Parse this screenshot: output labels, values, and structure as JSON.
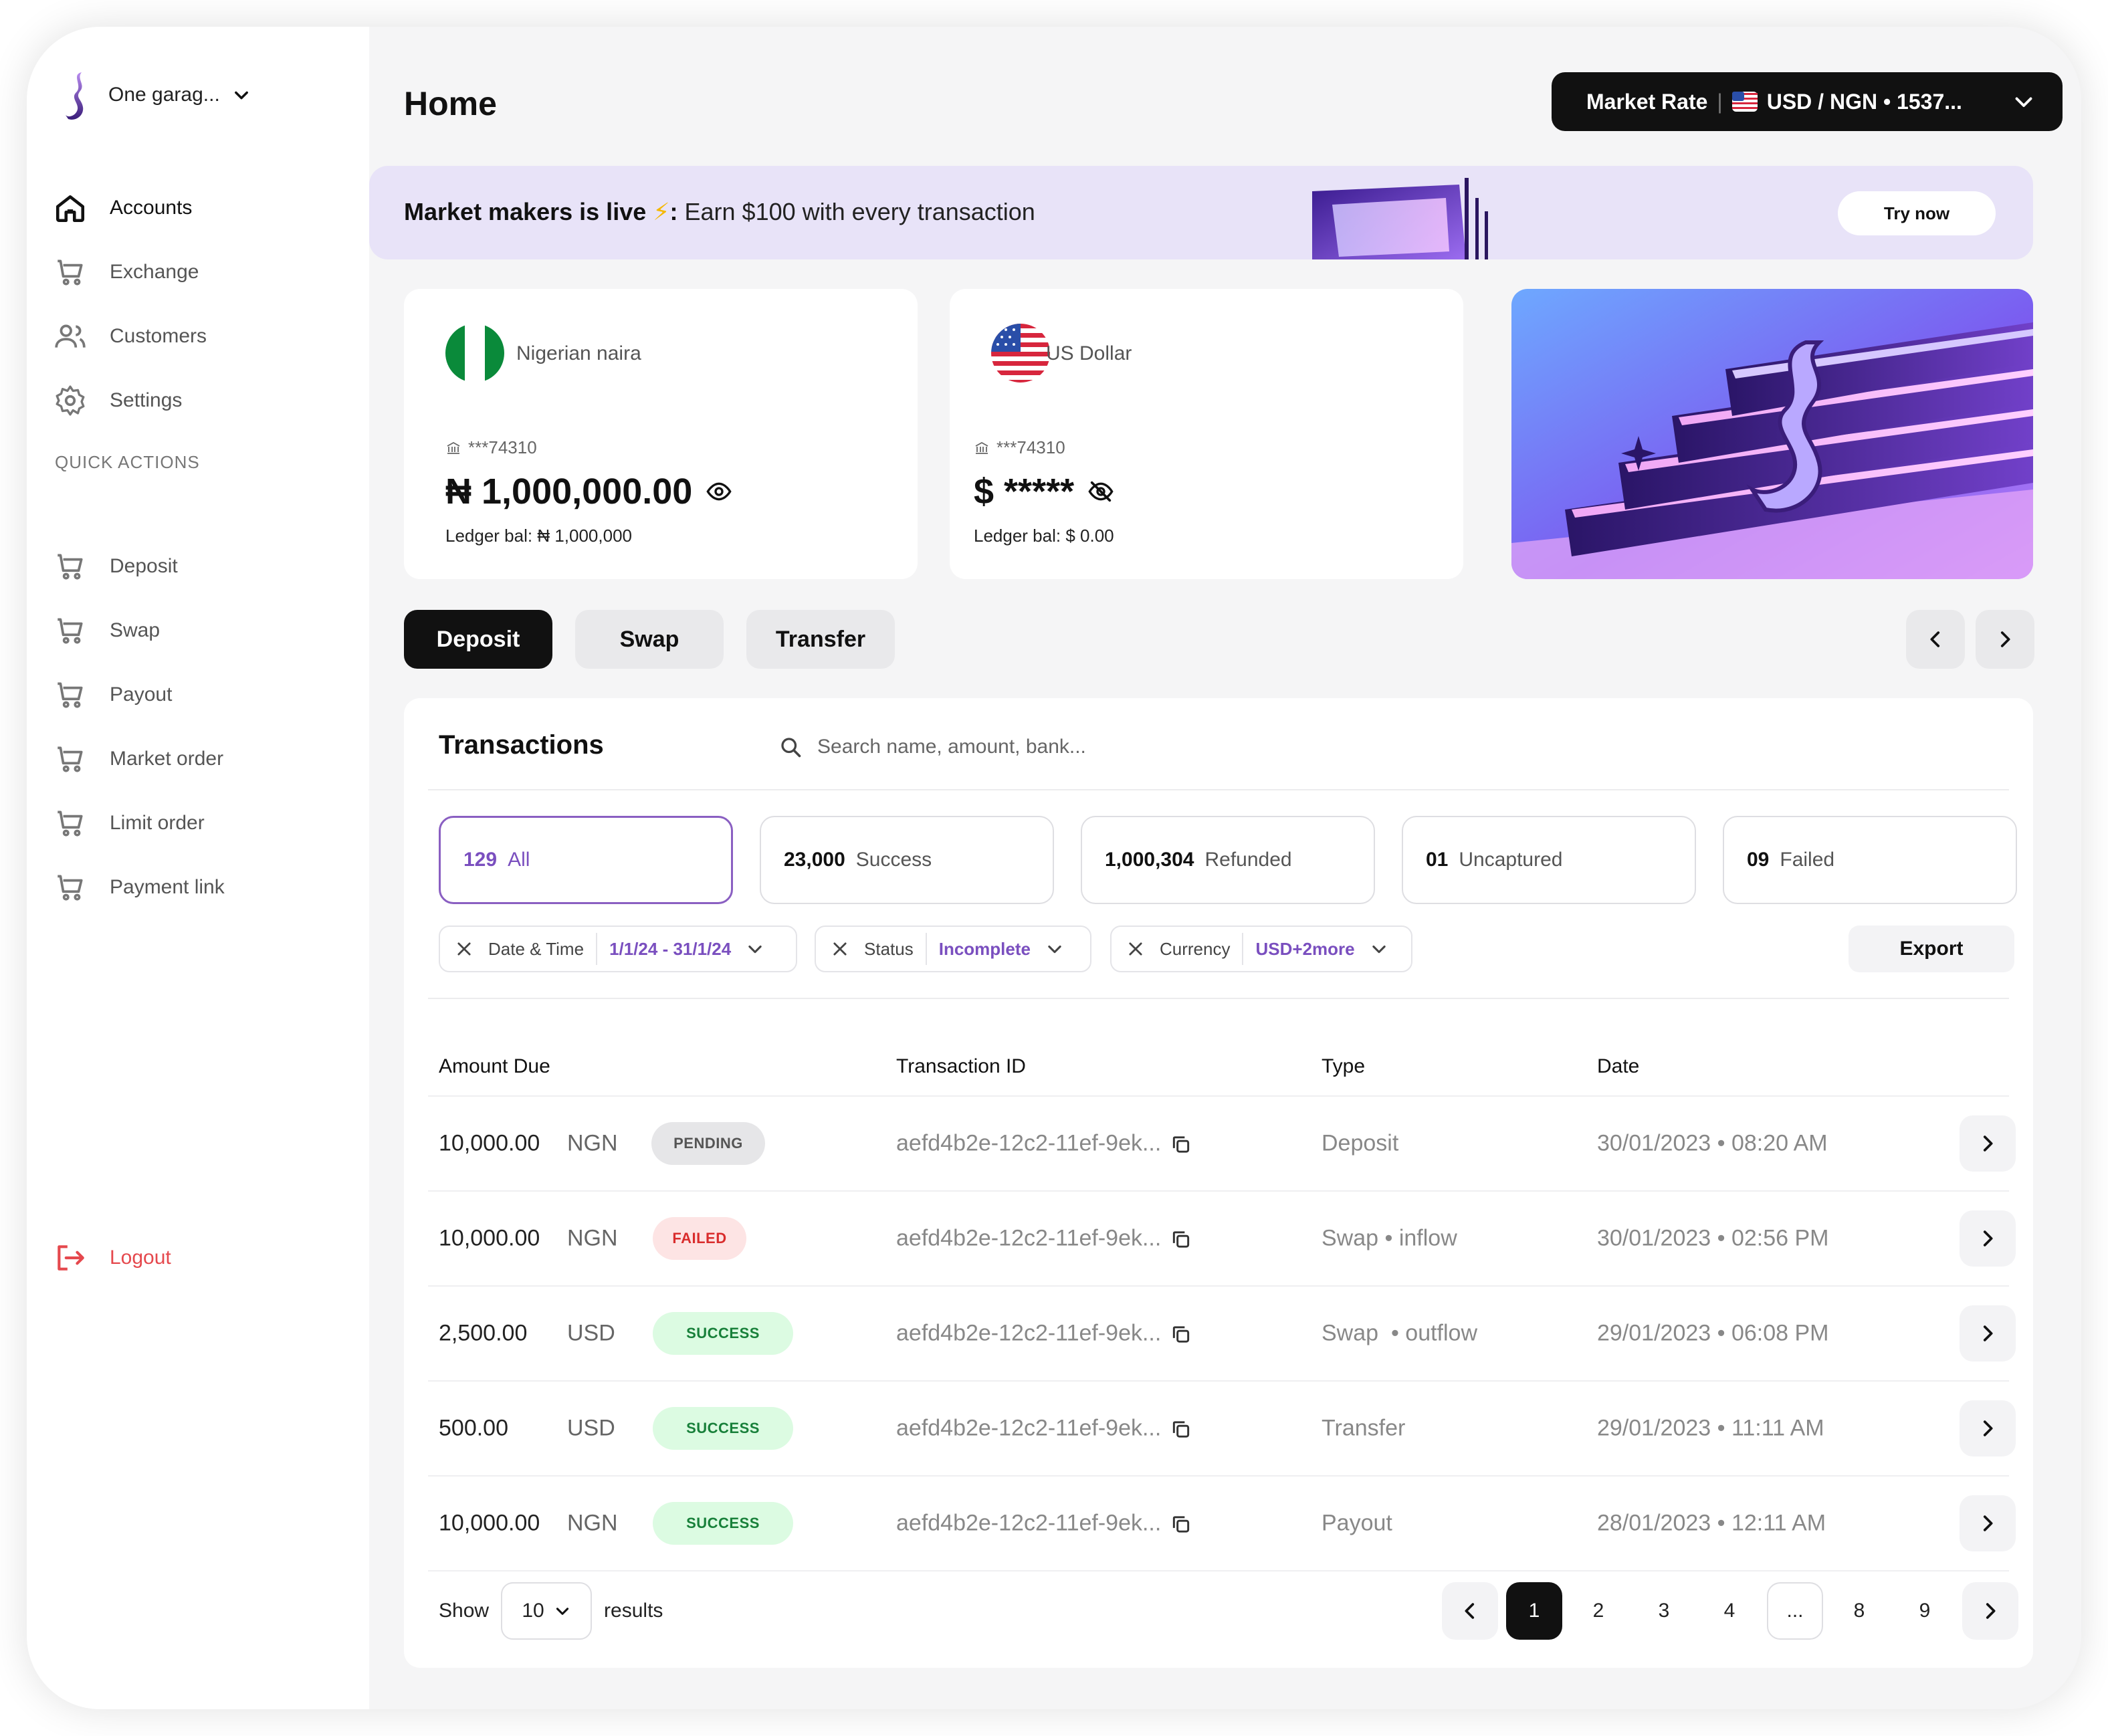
{
  "sidebar": {
    "org_name": "One garag...",
    "nav": [
      {
        "label": "Accounts",
        "icon": "home-icon"
      },
      {
        "label": "Exchange",
        "icon": "cart-icon"
      },
      {
        "label": "Customers",
        "icon": "users-icon"
      },
      {
        "label": "Settings",
        "icon": "gear-icon"
      }
    ],
    "quick_actions_label": "QUICK ACTIONS",
    "quick_actions": [
      {
        "label": "Deposit"
      },
      {
        "label": "Swap"
      },
      {
        "label": "Payout"
      },
      {
        "label": "Market order"
      },
      {
        "label": "Limit order"
      },
      {
        "label": "Payment link"
      }
    ],
    "logout_label": "Logout"
  },
  "header": {
    "title": "Home",
    "market_rate_label": "Market Rate",
    "market_rate_sep": "|",
    "market_rate_value": "USD / NGN • 1537..."
  },
  "banner": {
    "title": "Market makers is live",
    "emoji": "⚡",
    "colon": ":",
    "text": "Earn $100 with every transaction",
    "cta": "Try now"
  },
  "accounts": [
    {
      "currency_name": "Nigerian naira",
      "account": "***74310",
      "balance": "₦ 1,000,000.00",
      "ledger": "Ledger bal: ₦ 1,000,000"
    },
    {
      "currency_name": "US Dollar",
      "account": "***74310",
      "balance": "$ *****",
      "ledger": "Ledger bal: $ 0.00"
    }
  ],
  "action_tabs": [
    {
      "label": "Deposit"
    },
    {
      "label": "Swap"
    },
    {
      "label": "Transfer"
    }
  ],
  "transactions": {
    "title": "Transactions",
    "search_placeholder": "Search name, amount, bank...",
    "stats": [
      {
        "count": "129",
        "label": "All"
      },
      {
        "count": "23,000",
        "label": "Success"
      },
      {
        "count": "1,000,304",
        "label": "Refunded"
      },
      {
        "count": "01",
        "label": "Uncaptured"
      },
      {
        "count": "09",
        "label": "Failed"
      }
    ],
    "filters": [
      {
        "name": "Date & Time",
        "value": "1/1/24 - 31/1/24"
      },
      {
        "name": "Status",
        "value": "Incomplete"
      },
      {
        "name": "Currency",
        "value": "USD+2more"
      }
    ],
    "export_label": "Export",
    "columns": {
      "amount": "Amount Due",
      "id": "Transaction ID",
      "type": "Type",
      "date": "Date"
    },
    "rows": [
      {
        "amount": "10,000.00",
        "currency": "NGN",
        "status": "PENDING",
        "status_kind": "pending",
        "id": "aefd4b2e-12c2-11ef-9ek...",
        "type": "Deposit",
        "date": "30/01/2023 • 08:20 AM"
      },
      {
        "amount": "10,000.00",
        "currency": "NGN",
        "status": "FAILED",
        "status_kind": "failed",
        "id": "aefd4b2e-12c2-11ef-9ek...",
        "type": "Swap • inflow",
        "date": "30/01/2023 • 02:56 PM"
      },
      {
        "amount": "2,500.00",
        "currency": "USD",
        "status": "SUCCESS",
        "status_kind": "success",
        "id": "aefd4b2e-12c2-11ef-9ek...",
        "type": "Swap  • outflow",
        "date": "29/01/2023 • 06:08 PM"
      },
      {
        "amount": "500.00",
        "currency": "USD",
        "status": "SUCCESS",
        "status_kind": "success",
        "id": "aefd4b2e-12c2-11ef-9ek...",
        "type": "Transfer",
        "date": "29/01/2023 • 11:11 AM"
      },
      {
        "amount": "10,000.00",
        "currency": "NGN",
        "status": "SUCCESS",
        "status_kind": "success",
        "id": "aefd4b2e-12c2-11ef-9ek...",
        "type": "Payout",
        "date": "28/01/2023 • 12:11 AM"
      }
    ],
    "show_label": "Show",
    "page_size": "10",
    "results_label": "results",
    "pages": [
      "1",
      "2",
      "3",
      "4",
      "...",
      "8",
      "9"
    ],
    "current_page": "1"
  },
  "colors": {
    "accent": "#7a4fbf",
    "banner_bg": "#e8e3f8",
    "logout": "#e5484d",
    "success": "#18803a",
    "failed": "#d92d2d"
  }
}
